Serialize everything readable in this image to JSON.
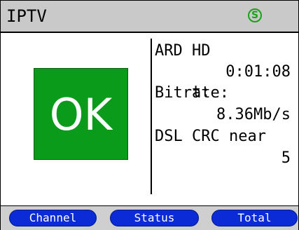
{
  "header": {
    "title": "IPTV",
    "status_icon_glyph": "S",
    "status_icon_name": "sync-status-icon",
    "status_color": "#1aa31a"
  },
  "result": {
    "label": "OK",
    "color": "#0a9b1a"
  },
  "info": {
    "channel": "ARD HD",
    "time_label": "t:",
    "time_value": "0:01:08",
    "bitrate_label": "Bitrate:",
    "bitrate_value": "8.36Mb/s",
    "crc_label": "DSL CRC near",
    "crc_value": "5"
  },
  "softkeys": [
    {
      "label": "Channel"
    },
    {
      "label": "Status"
    },
    {
      "label": "Total"
    }
  ]
}
